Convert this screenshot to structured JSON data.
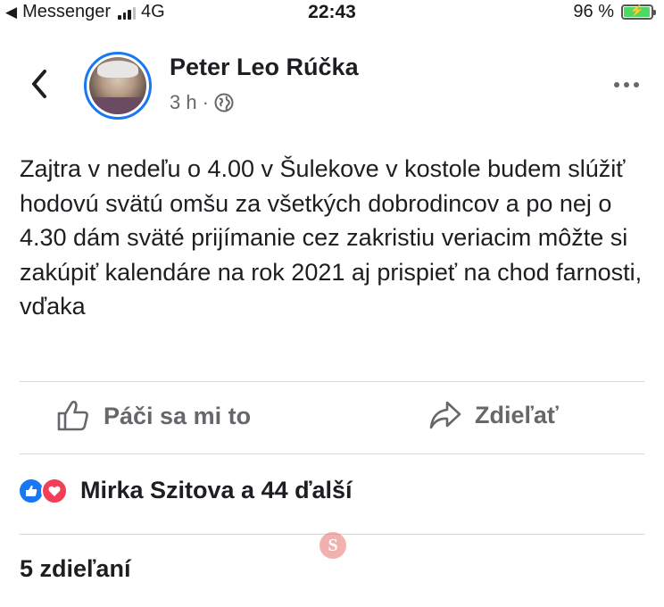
{
  "status_bar": {
    "carrier": "Messenger",
    "network": "4G",
    "time": "22:43",
    "battery_percent": "96 %",
    "signal_bars_active": 3,
    "battery_level": 0.96,
    "battery_color": "#4cd964"
  },
  "header": {
    "back_icon": "chevron-left-icon",
    "author_name": "Peter Leo Rúčka",
    "time_ago": "3 h",
    "separator": "·",
    "audience_icon": "globe-icon",
    "more_icon": "more-horizontal-icon"
  },
  "post": {
    "text": "Zajtra v nedeľu o 4.00 v Šulekove v kostole budem slúžiť hodovú svätú omšu za všetkých dobrodincov a po nej o 4.30 dám sväté prijímanie cez zakristiu veriacim môžte si zakúpiť kalendáre na rok 2021 aj prispieť na chod farnosti, vďaka"
  },
  "actions": {
    "like_label": "Páči sa mi to",
    "share_label": "Zdieľať",
    "like_icon": "thumbs-up-icon",
    "share_icon": "share-arrow-icon"
  },
  "reactions": {
    "summary": "Mirka Szitova a 44 ďalší",
    "icons": [
      "like-reaction-icon",
      "love-reaction-icon"
    ],
    "like_color": "#1877f2",
    "love_color": "#f33e58"
  },
  "shares": {
    "label": "5 zdieľaní"
  },
  "colors": {
    "accent": "#1877f2",
    "muted_text": "#65676b",
    "divider": "#d6d6d6"
  }
}
